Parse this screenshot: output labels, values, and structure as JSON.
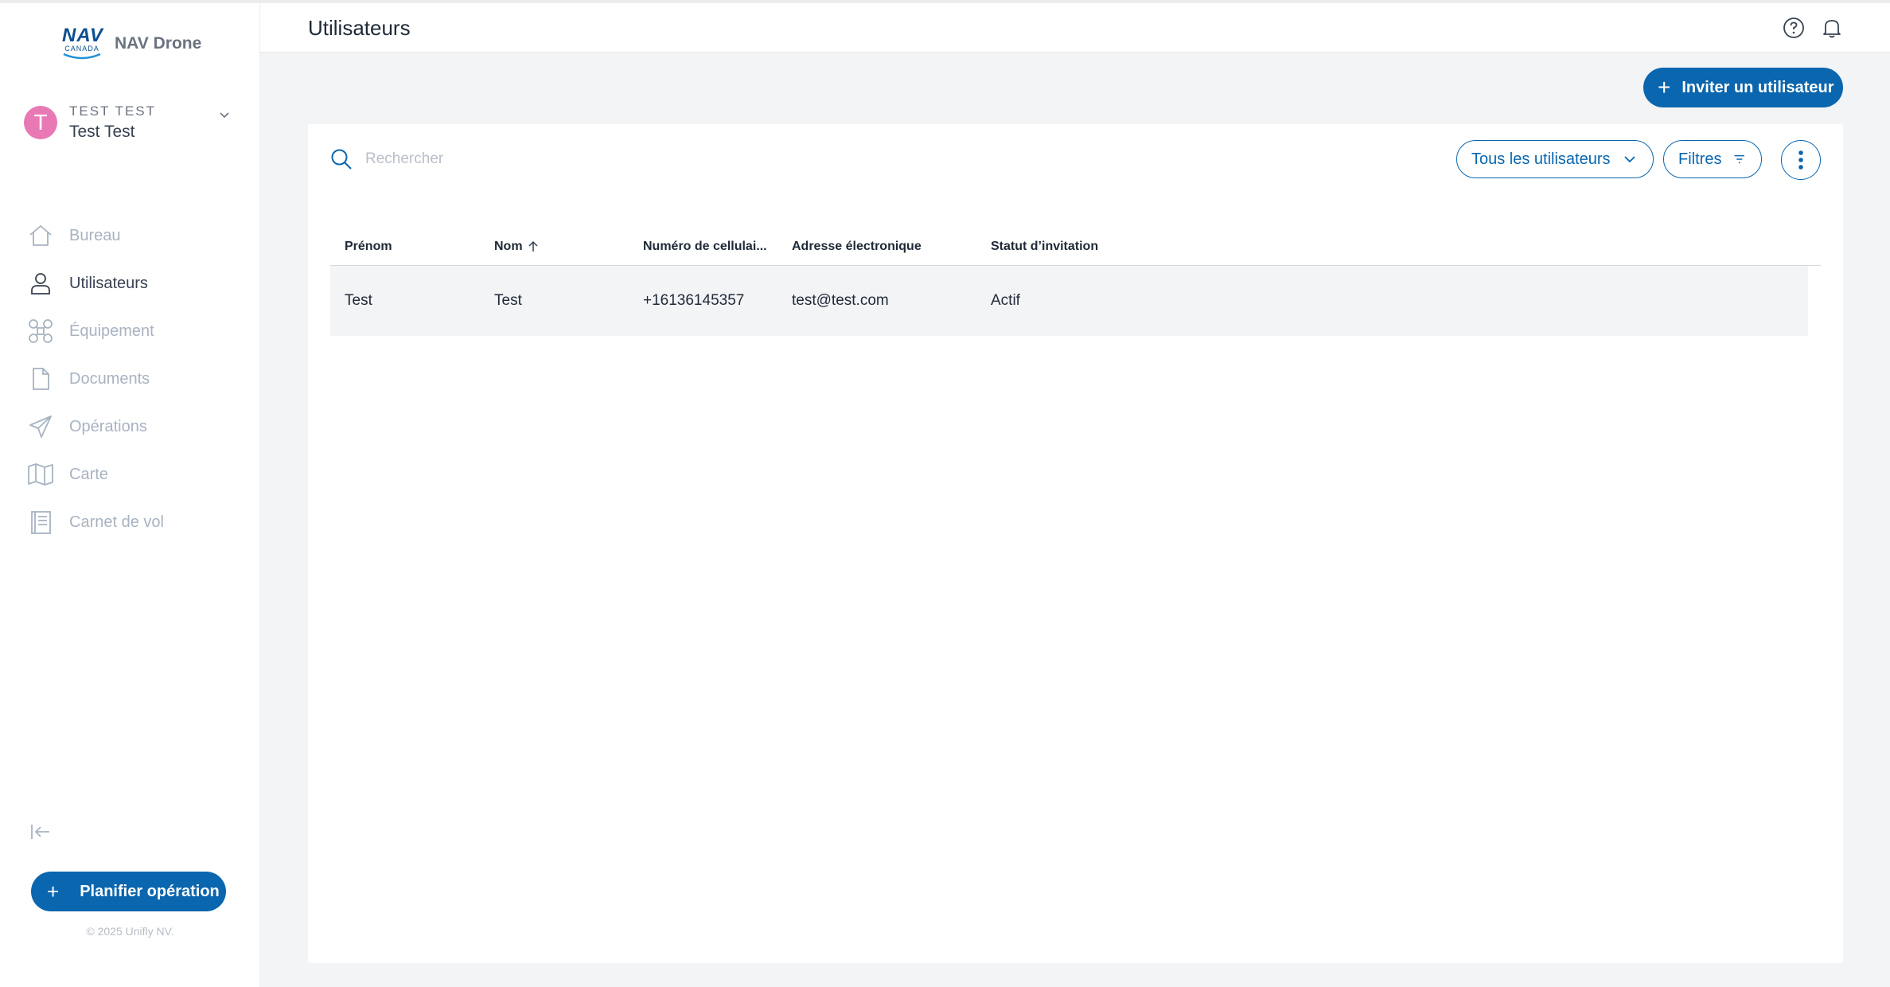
{
  "brand": {
    "logo_text": "NAV",
    "logo_subtext": "CANADA",
    "app_name": "NAV Drone"
  },
  "user": {
    "initial": "T",
    "org": "TEST TEST",
    "name": "Test Test"
  },
  "nav": {
    "items": [
      {
        "label": "Bureau",
        "icon": "home-icon",
        "active": false
      },
      {
        "label": "Utilisateurs",
        "icon": "user-icon",
        "active": true
      },
      {
        "label": "Équipement",
        "icon": "drone-icon",
        "active": false
      },
      {
        "label": "Documents",
        "icon": "document-icon",
        "active": false
      },
      {
        "label": "Opérations",
        "icon": "send-icon",
        "active": false
      },
      {
        "label": "Carte",
        "icon": "map-icon",
        "active": false
      },
      {
        "label": "Carnet de vol",
        "icon": "logbook-icon",
        "active": false
      }
    ]
  },
  "sidebar_footer": {
    "plan_label": "Planifier opération",
    "copyright": "© 2025 Unifly NV."
  },
  "header": {
    "title": "Utilisateurs"
  },
  "actions": {
    "invite_label": "Inviter un utilisateur"
  },
  "toolbar": {
    "search_placeholder": "Rechercher",
    "scope_label": "Tous les utilisateurs",
    "filters_label": "Filtres"
  },
  "table": {
    "columns": [
      "Prénom",
      "Nom",
      "Numéro de cellulai...",
      "Adresse électronique",
      "Statut d’invitation"
    ],
    "sorted_column": 1,
    "sort_direction": "ascending",
    "rows": [
      [
        "Test",
        "Test",
        "+16136145357",
        "test@test.com",
        "Actif"
      ]
    ]
  },
  "colors": {
    "primary": "#0a66ae",
    "avatar": "#e879b5",
    "nav_inactive": "#a8b3c1"
  }
}
